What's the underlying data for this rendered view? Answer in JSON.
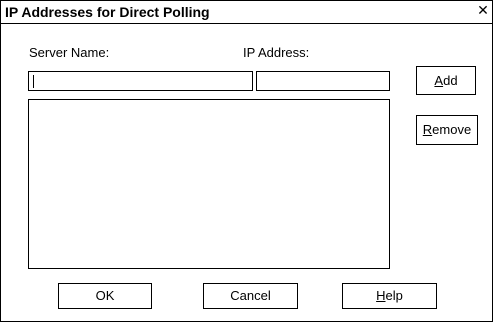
{
  "dialog": {
    "title": "IP Addresses for Direct Polling",
    "close_glyph": "✕"
  },
  "form": {
    "server_name_label": "Server Name:",
    "ip_address_label": "IP Address:",
    "server_name_value": "",
    "ip_address_value": ""
  },
  "buttons": {
    "add": {
      "mnemonic": "A",
      "rest": "dd"
    },
    "remove": {
      "mnemonic": "R",
      "rest": "emove"
    },
    "ok": "OK",
    "cancel": "Cancel",
    "help": {
      "mnemonic": "H",
      "rest": "elp"
    }
  },
  "list": {
    "items": []
  }
}
